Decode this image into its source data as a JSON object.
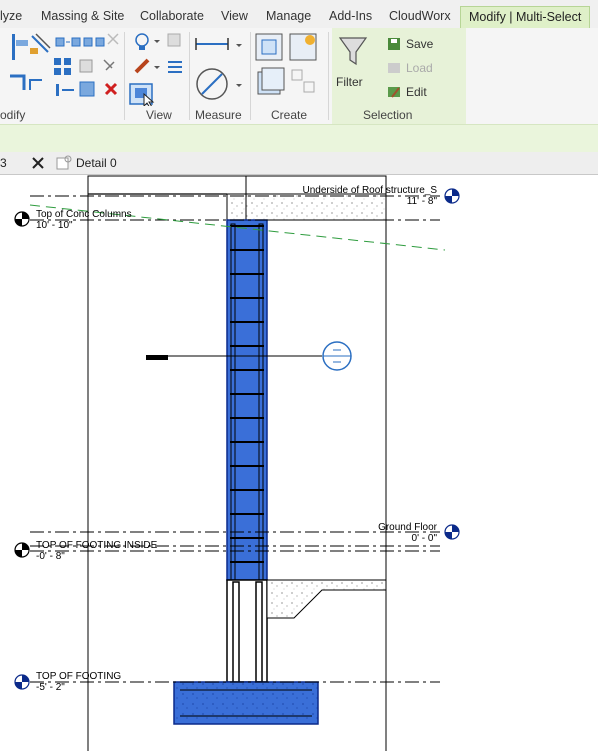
{
  "ribbon_tabs": [
    {
      "label": "lyze",
      "active": false
    },
    {
      "label": "Massing & Site",
      "active": false
    },
    {
      "label": "Collaborate",
      "active": false
    },
    {
      "label": "View",
      "active": false
    },
    {
      "label": "Manage",
      "active": false
    },
    {
      "label": "Add-Ins",
      "active": false
    },
    {
      "label": "CloudWorx",
      "active": false
    },
    {
      "label": "Modify | Multi-Select",
      "active": true
    }
  ],
  "panels": {
    "modify": "odify",
    "view": "View",
    "measure": "Measure",
    "create": "Create",
    "selection": "Selection"
  },
  "selection_buttons": {
    "filter": "Filter",
    "save": "Save",
    "load": "Load",
    "edit": "Edit"
  },
  "view_tabs": {
    "left_fragment": "3",
    "active_view": "Detail 0"
  },
  "levels": {
    "roof": {
      "name": "Underside of Roof structure_S",
      "elevation": "11' - 8\""
    },
    "conc_columns": {
      "name": "Top of Conc Columns",
      "elevation": "10' - 10\""
    },
    "ground_floor": {
      "name": "Ground Floor",
      "elevation": "0' - 0\""
    },
    "footing_inside": {
      "name": "TOP OF FOOTING INSIDE",
      "elevation": "-0' - 8\""
    },
    "footing": {
      "name": "TOP OF FOOTING",
      "elevation": "-5' - 2\""
    }
  },
  "colors": {
    "selected_fill": "#3a6fd8",
    "selected_stroke": "#0b2a8a",
    "context_tab": "#dff0c8",
    "level_line_green": "#2e9c3e"
  }
}
